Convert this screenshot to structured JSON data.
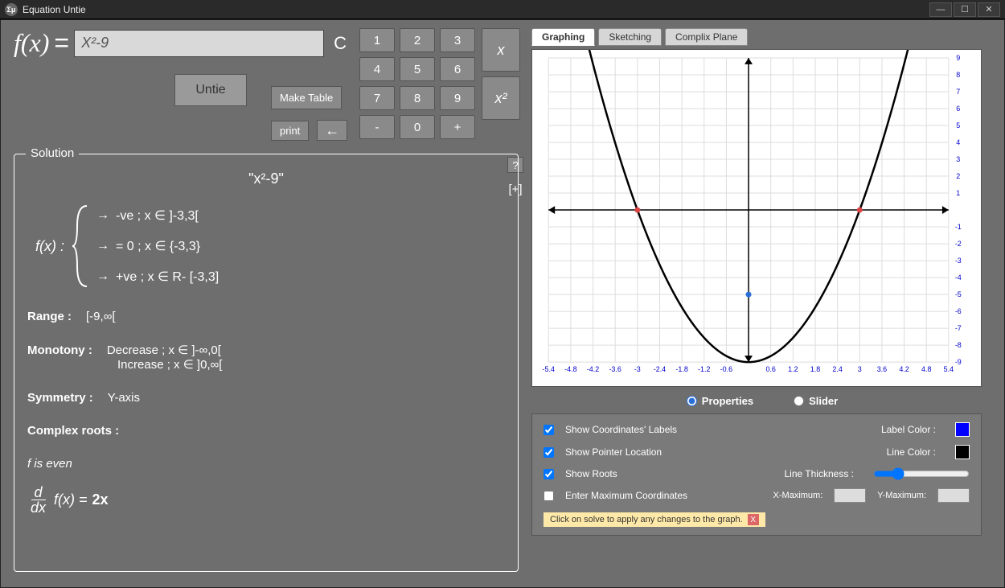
{
  "window": {
    "title": "Equation Untie"
  },
  "input": {
    "prefix": "f(x)",
    "equals": "=",
    "value": "X²-9",
    "clear": "C"
  },
  "buttons": {
    "untie": "Untie",
    "make_table": "Make Table",
    "print": "print",
    "back": "←",
    "help": "?",
    "expand": "[+]"
  },
  "keys": {
    "n1": "1",
    "n2": "2",
    "n3": "3",
    "n4": "4",
    "n5": "5",
    "n6": "6",
    "n7": "7",
    "n8": "8",
    "n9": "9",
    "n0": "0",
    "minus": "-",
    "plus": "+",
    "x": "x",
    "x2": "x²"
  },
  "solution": {
    "legend": "Solution",
    "title": "\"x²-9\"",
    "fx": "f(x) :",
    "case_neg": "-ve ; x ∈ ]-3,3[",
    "case_zero": "= 0 ; x ∈ {-3,3}",
    "case_pos": "+ve ; x ∈ R- [-3,3]",
    "range_lbl": "Range :",
    "range_val": "[-9,∞[",
    "mono_lbl": "Monotony :",
    "mono_dec": "Decrease ; x ∈ ]-∞,0[",
    "mono_inc": "Increase ; x ∈ ]0,∞[",
    "sym_lbl": "Symmetry :",
    "sym_val": "Y-axis",
    "complex_lbl": "Complex roots :",
    "parity": "f is even",
    "deriv_eq": "f(x) =",
    "deriv_val": "2x",
    "d": "d",
    "dx": "dx"
  },
  "tabs": {
    "graphing": "Graphing",
    "sketching": "Sketching",
    "complex": "Complix Plane"
  },
  "radios": {
    "properties": "Properties",
    "slider": "Slider"
  },
  "properties": {
    "show_coords": "Show Coordinates' Labels",
    "show_pointer": "Show Pointer Location",
    "show_roots": "Show Roots",
    "enter_max": "Enter Maximum Coordinates",
    "label_color": "Label Color :",
    "line_color": "Line Color :",
    "line_thick": "Line Thickness :",
    "x_max": "X-Maximum:",
    "y_max": "Y-Maximum:",
    "label_color_val": "#0000ff",
    "line_color_val": "#000000",
    "hint": "Click on solve to apply any changes to the graph.",
    "hint_close": "X"
  },
  "chart_data": {
    "type": "line",
    "title": "",
    "xlabel": "",
    "ylabel": "",
    "xlim": [
      -5.4,
      5.4
    ],
    "ylim": [
      -9,
      9
    ],
    "x_ticks": [
      -5.4,
      -4.8,
      -4.2,
      -3.6,
      -3,
      -2.4,
      -1.8,
      -1.2,
      -0.6,
      0.6,
      1.2,
      1.8,
      2.4,
      3,
      3.6,
      4.2,
      4.8,
      5.4
    ],
    "y_ticks": [
      -9,
      -8,
      -7,
      -6,
      -5,
      -4,
      -3,
      -2,
      -1,
      1,
      2,
      3,
      4,
      5,
      6,
      7,
      8,
      9
    ],
    "function": "x^2 - 9",
    "series": [
      {
        "name": "f(x)",
        "x": [
          -4.24,
          -4,
          -3.5,
          -3,
          -2.5,
          -2,
          -1.5,
          -1,
          -0.5,
          0,
          0.5,
          1,
          1.5,
          2,
          2.5,
          3,
          3.5,
          4,
          4.24
        ],
        "y": [
          9,
          7,
          3.25,
          0,
          -2.75,
          -5,
          -6.75,
          -8,
          -8.75,
          -9,
          -8.75,
          -8,
          -6.75,
          -5,
          -2.75,
          0,
          3.25,
          7,
          9
        ]
      }
    ],
    "roots": [
      [
        -3,
        0
      ],
      [
        3,
        0
      ]
    ],
    "vertex": [
      0,
      -9
    ]
  }
}
